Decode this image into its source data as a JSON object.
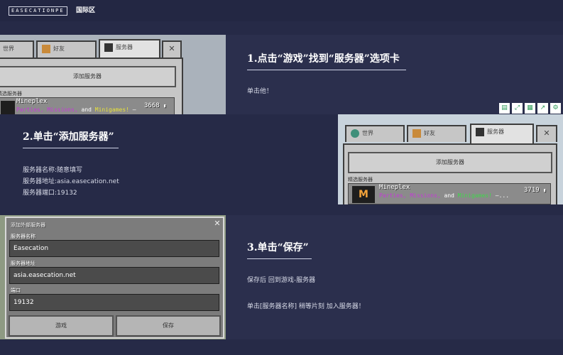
{
  "header": {
    "logo": "EASECATIONPE",
    "region": "国际区"
  },
  "step1": {
    "title": "1.点击“游戏”找到“服务器”选项卡",
    "desc": "单击他！",
    "screenshot": {
      "tabs": [
        "世界",
        "好友",
        "服务器"
      ],
      "close": "✕",
      "add_button": "添加服务器",
      "section": "精选服务器",
      "server_name": "Mineplex",
      "server_desc": [
        "Parties,",
        " Missions,",
        " and",
        " Minigames!",
        " –"
      ],
      "server_count": "3668"
    }
  },
  "step2": {
    "title": "2.单击“添加服务器”",
    "lines": [
      "服务器名称:随意填写",
      "服务器地址:asia.easecation.net",
      "服务器端口:19132"
    ],
    "screenshot": {
      "tabs": [
        "世界",
        "好友",
        "服务器"
      ],
      "close": "✕",
      "add_button": "添加服务器",
      "section": "精选服务器",
      "server_name": "Mineplex",
      "server_desc": [
        "Parties,",
        " Missions,",
        " and",
        " Minigames!",
        " –..."
      ],
      "server_count": "3719"
    }
  },
  "toolbar_icons": [
    "document-icon",
    "expand-icon",
    "qr-icon",
    "share-icon",
    "settings-icon"
  ],
  "step3": {
    "title": "3.单击“保存”",
    "lines": [
      "保存后 回到游戏-服务器",
      "单击[服务器名称] 稍等片刻 加入服务器！"
    ],
    "dialog": {
      "title": "添加外部服务器",
      "close": "✕",
      "name_label": "服务器名称",
      "name_value": "Easecation",
      "address_label": "服务器地址",
      "address_value": "asia.easecation.net",
      "port_label": "端口",
      "port_value": "19132",
      "cancel_button": "游戏",
      "save_button": "保存"
    }
  },
  "colors": {
    "background": "#262a47",
    "header": "#232743",
    "desc_purple": "#c43bd6",
    "desc_yellow": "#e8e23a",
    "desc_green": "#3fd84a",
    "accent_green": "#2e9b58"
  }
}
